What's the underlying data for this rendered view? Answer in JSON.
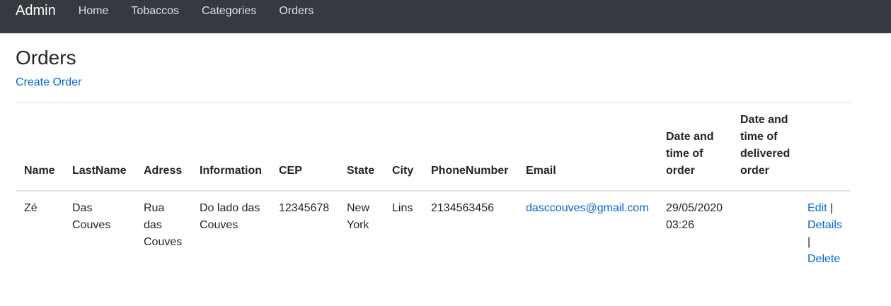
{
  "nav": {
    "brand": "Admin",
    "items": [
      "Home",
      "Tobaccos",
      "Categories",
      "Orders"
    ]
  },
  "page": {
    "title": "Orders",
    "create_label": "Create Order"
  },
  "table": {
    "headers": [
      "Name",
      "LastName",
      "Adress",
      "Information",
      "CEP",
      "State",
      "City",
      "PhoneNumber",
      "Email",
      "Date and time of order",
      "Date and time of delivered order",
      ""
    ],
    "rows": [
      {
        "name": "Zé",
        "lastname": "Das Couves",
        "adress": "Rua das Couves",
        "information": "Do lado das Couves",
        "cep": "12345678",
        "state": "New York",
        "city": "Lins",
        "phone": "2134563456",
        "email": "dasccouves@gmail.com",
        "date_order": "29/05/2020 03:26",
        "date_delivered": "",
        "actions": {
          "edit": "Edit",
          "details": "Details",
          "delete": "Delete",
          "separator": "|"
        }
      }
    ]
  },
  "colors": {
    "navbar": "#343a40",
    "link": "#0366d6"
  }
}
